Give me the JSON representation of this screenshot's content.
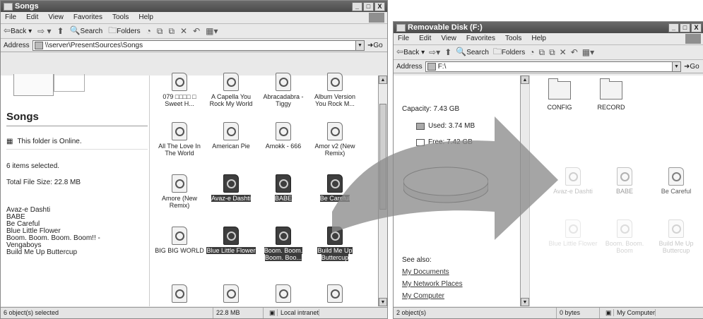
{
  "left_window": {
    "title": "Songs",
    "title_buttons": [
      "_",
      "□",
      "X"
    ],
    "menu": [
      "File",
      "Edit",
      "View",
      "Favorites",
      "Tools",
      "Help"
    ],
    "toolbar": {
      "back": "Back",
      "search": "Search",
      "folders": "Folders"
    },
    "address_label": "Address",
    "address_value": "\\\\server\\PresentSources\\Songs",
    "go": "Go",
    "task_pane": {
      "folder_title": "Songs",
      "online": "This folder is Online.",
      "items_selected": "6 items selected.",
      "total_size": "Total File Size: 22.8 MB",
      "selected_names": [
        "Avaz-e Dashti",
        "BABE",
        "Be Careful",
        "Blue Little Flower",
        "Boom. Boom. Boom. Boom!! -",
        "Vengaboys",
        "Build Me Up Buttercup"
      ]
    },
    "files": [
      {
        "name": "079 □□□□ □ Sweet H...",
        "selected": false
      },
      {
        "name": "A Capella You Rock My World",
        "selected": false
      },
      {
        "name": "Abracadabra - Tiggy",
        "selected": false
      },
      {
        "name": "Album Version You Rock M...",
        "selected": false
      },
      {
        "name": "All The Love In The World",
        "selected": false
      },
      {
        "name": "American Pie",
        "selected": false
      },
      {
        "name": "Amokk - 666",
        "selected": false
      },
      {
        "name": "Amor v2 (New Remix)",
        "selected": false
      },
      {
        "name": "Amore (New Remix)",
        "selected": false
      },
      {
        "name": "Avaz-e Dashti",
        "selected": true
      },
      {
        "name": "BABE",
        "selected": true
      },
      {
        "name": "Be Careful",
        "selected": true
      },
      {
        "name": "BIG BIG WORLD",
        "selected": false
      },
      {
        "name": "Blue Little Flower",
        "selected": true
      },
      {
        "name": "Boom. Boom. Boom. Boo...",
        "selected": true
      },
      {
        "name": "Build Me Up Buttercup",
        "selected": true
      }
    ],
    "status": {
      "selection": "6 object(s) selected",
      "size": "22.8 MB",
      "zone": "Local intranet"
    }
  },
  "right_window": {
    "title": "Removable Disk (F:)",
    "title_buttons": [
      "_",
      "□",
      "X"
    ],
    "menu": [
      "File",
      "Edit",
      "View",
      "Favorites",
      "Tools",
      "Help"
    ],
    "toolbar": {
      "back": "Back",
      "search": "Search",
      "folders": "Folders"
    },
    "address_label": "Address",
    "address_value": "F:\\",
    "go": "Go",
    "task_pane": {
      "capacity": "Capacity: 7.43 GB",
      "used": "Used: 3.74 MB",
      "free": "Free: 7.42 GB",
      "used_fraction": 0.0005,
      "see_also": "See also:",
      "links": [
        "My Documents",
        "My Network Places",
        "My Computer"
      ]
    },
    "folders": [
      "CONFIG",
      "RECORD"
    ],
    "files_faded": [
      "Avaz-e Dashti",
      "BABE",
      "Be Careful",
      "Blue Little Flower",
      "Boom. Boom. Boom",
      "Build Me Up Buttercup"
    ],
    "status": {
      "selection": "2 object(s)",
      "size": "0 bytes",
      "zone": "My Computer"
    }
  },
  "colors": {
    "selection": "#3c3c3c",
    "arrow": "#8c8c8c",
    "titlebar": "#555555"
  }
}
